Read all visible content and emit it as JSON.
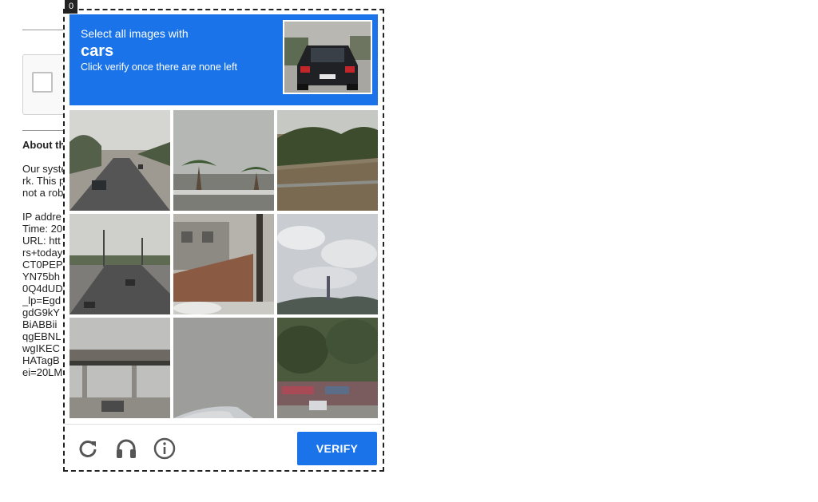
{
  "background_page": {
    "heading": "About th",
    "lines": [
      "Our syste",
      "rk. This p",
      "not a rob",
      "",
      "IP addre",
      "Time: 20",
      "URL: htt",
      "rs+today",
      "CT0PEP",
      "YN75bh",
      "0Q4dUD",
      "_lp=Egd",
      "gdG9kY",
      "BiABBii",
      "qgEBNL",
      "wgIKEC",
      "HATagB",
      "ei=20LM"
    ]
  },
  "frame_index": "0",
  "challenge": {
    "instruction_line1": "Select all images with",
    "target_object": "cars",
    "instruction_line3": "Click verify once there are none left",
    "sample_image": "dark-hatchback-rear-view",
    "tiles": [
      {
        "scene": "highway-with-trees"
      },
      {
        "scene": "palm-trees-road"
      },
      {
        "scene": "hillside-with-bushes"
      },
      {
        "scene": "highway-with-light-poles"
      },
      {
        "scene": "building-and-wall"
      },
      {
        "scene": "cloudy-sky-and-hills"
      },
      {
        "scene": "gas-station-canopy"
      },
      {
        "scene": "asphalt-with-car-roof"
      },
      {
        "scene": "trees-and-storefront"
      }
    ],
    "buttons": {
      "reload": "reload-icon",
      "audio": "headphones-icon",
      "help": "info-icon",
      "verify_label": "VERIFY"
    }
  },
  "colors": {
    "accent": "#1a73e8"
  }
}
